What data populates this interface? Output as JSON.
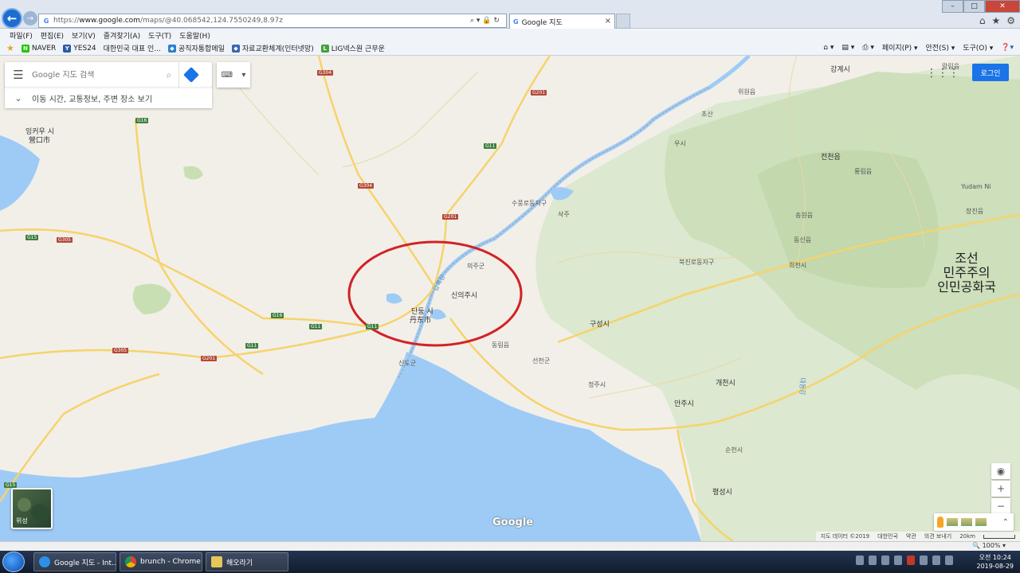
{
  "browser": {
    "url_prefix": "https://",
    "url_host": "www.google.com",
    "url_path": "/maps/@40.068542,124.7550249,8.97z",
    "tab_title": "Google 지도",
    "tab_close": "×",
    "url_icons": "⌕ ▾ 🔒 ↻",
    "win_minimize": "–",
    "win_maximize": "□",
    "win_close": "✕",
    "home_icon": "⌂",
    "star_icon": "★",
    "gear_icon": "⚙"
  },
  "menu": [
    "파일(F)",
    "편집(E)",
    "보기(V)",
    "즐겨찾기(A)",
    "도구(T)",
    "도움말(H)"
  ],
  "favorites": [
    {
      "label": "NAVER",
      "icon": "N",
      "color": "#1ec800"
    },
    {
      "label": "YES24",
      "icon": "Y",
      "color": "#2b5aa7"
    },
    {
      "label": "대한민국 대표 인...",
      "icon": "",
      "color": ""
    },
    {
      "label": "공직자통합메일",
      "icon": "◆",
      "color": "#2d7fcf"
    },
    {
      "label": "자료교환체계(인터넷망)",
      "icon": "◆",
      "color": "#3a66b0"
    },
    {
      "label": "LIG넥스원 근무운",
      "icon": "L",
      "color": "#41a13a"
    }
  ],
  "commands": [
    "페이지(P) ▾",
    "안전(S) ▾",
    "도구(O) ▾"
  ],
  "maps": {
    "search_placeholder": "Google 지도 검색",
    "explore_label": "이동 시간, 교통정보, 주변 장소 보기",
    "login_label": "로그인",
    "satellite_label": "위성",
    "google_logo": "Google",
    "attribution": [
      "지도 데이터 ©2019",
      "대한민국",
      "약관",
      "의견 보내기",
      "20km"
    ],
    "country_label": [
      "조선",
      "민주주의",
      "인민공화국"
    ],
    "labels": [
      {
        "text": "잉커우 시",
        "cls": "city"
      },
      {
        "text": "營口市",
        "cls": "city"
      },
      {
        "text": "단둥 시",
        "cls": "city"
      },
      {
        "text": "丹东市",
        "cls": "city"
      },
      {
        "text": "신의주시",
        "cls": "city"
      },
      {
        "text": "의주군",
        "cls": ""
      },
      {
        "text": "구성시",
        "cls": "city"
      },
      {
        "text": "동림읍",
        "cls": ""
      },
      {
        "text": "선천군",
        "cls": ""
      },
      {
        "text": "정주시",
        "cls": ""
      },
      {
        "text": "개천시",
        "cls": "city"
      },
      {
        "text": "안주시",
        "cls": "city"
      },
      {
        "text": "순천시",
        "cls": ""
      },
      {
        "text": "평성시",
        "cls": "city"
      },
      {
        "text": "강계시",
        "cls": "city"
      },
      {
        "text": "전천읍",
        "cls": "city"
      },
      {
        "text": "희천시",
        "cls": ""
      },
      {
        "text": "송원읍",
        "cls": ""
      },
      {
        "text": "동신읍",
        "cls": ""
      },
      {
        "text": "북진로동자구",
        "cls": ""
      },
      {
        "text": "수풍로동자구",
        "cls": ""
      },
      {
        "text": "삭주",
        "cls": ""
      },
      {
        "text": "우시",
        "cls": ""
      },
      {
        "text": "초산",
        "cls": ""
      },
      {
        "text": "위원읍",
        "cls": ""
      },
      {
        "text": "룡림읍",
        "cls": ""
      },
      {
        "text": "Yudam Ni",
        "cls": ""
      },
      {
        "text": "장진읍",
        "cls": ""
      },
      {
        "text": "랑림읍",
        "cls": ""
      },
      {
        "text": "신도군",
        "cls": ""
      },
      {
        "text": "압록강",
        "cls": "water"
      },
      {
        "text": "대동강",
        "cls": "water"
      }
    ],
    "shields": [
      "G304",
      "G201",
      "G16",
      "G11",
      "G304",
      "G201",
      "G15",
      "G305",
      "G16",
      "G11",
      "G11",
      "G305",
      "G201",
      "G11",
      "G15"
    ],
    "zoom_in": "+",
    "zoom_out": "−",
    "locate_icon": "◉",
    "expand_icon": "⌃"
  },
  "status": {
    "zoom": "🔍 100% ▾"
  },
  "taskbar": {
    "items": [
      "Google 지도 - Int...",
      "brunch - Chrome",
      "해오라기"
    ],
    "time": "오전 10:24",
    "date": "2019-08-29"
  }
}
